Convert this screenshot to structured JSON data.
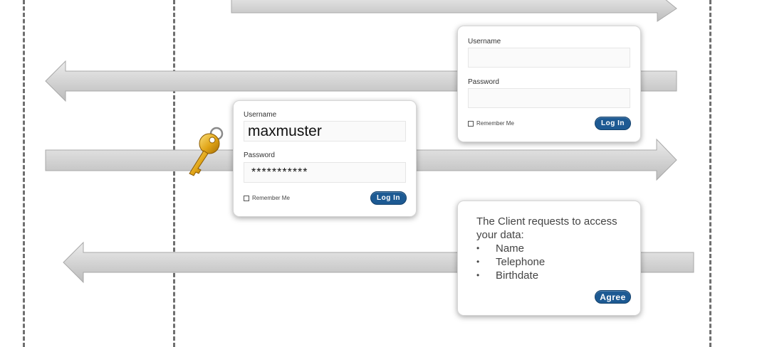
{
  "login_form_empty": {
    "username_label": "Username",
    "username_value": "",
    "password_label": "Password",
    "password_value": "",
    "remember_label": "Remember Me",
    "login_button": "Log In"
  },
  "login_form_filled": {
    "username_label": "Username",
    "username_value": "maxmuster",
    "password_label": "Password",
    "password_value": "***********",
    "remember_label": "Remember Me",
    "login_button": "Log In"
  },
  "consent_dialog": {
    "intro": "The Client requests to access your data:",
    "items": [
      "Name",
      "Telephone",
      "Birthdate"
    ],
    "agree_button": "Agree"
  },
  "colors": {
    "button_blue": "#1d5a93",
    "arrow_gray": "#d3d3d3",
    "lane_line": "#6f6f6f"
  },
  "icons": [
    "key-icon",
    "checkbox-icon"
  ]
}
